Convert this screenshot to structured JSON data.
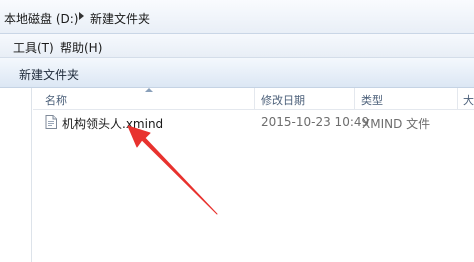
{
  "address": {
    "crumbs": [
      "本地磁盘 (D:)",
      "新建文件夹"
    ]
  },
  "menu": {
    "tools": "工具(T)",
    "help": "帮助(H)"
  },
  "command_bar": {
    "new_folder": "新建文件夹"
  },
  "columns": {
    "name": "名称",
    "date_modified": "修改日期",
    "type": "类型",
    "size": "大小"
  },
  "files": [
    {
      "name": "机构领头人.xmind",
      "date_modified": "2015-10-23 10:49",
      "type": "XMIND 文件",
      "icon": "document-icon"
    }
  ],
  "annotation": {
    "arrow_color": "#e8322e"
  }
}
